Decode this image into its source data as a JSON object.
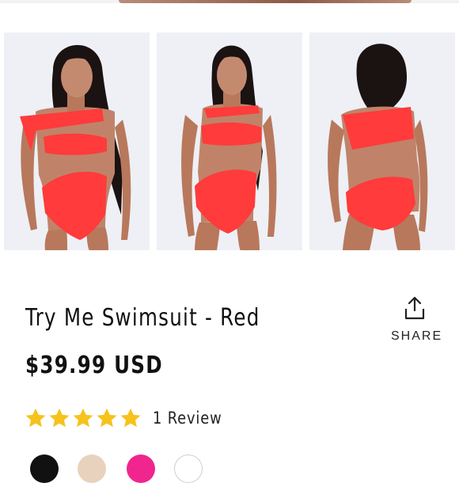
{
  "product": {
    "title": "Try Me Swimsuit - Red",
    "price": "$39.99 USD",
    "share_label": "SHARE",
    "rating": {
      "stars": 5,
      "max": 5,
      "review_label": "1 Review"
    }
  },
  "gallery": {
    "images": [
      {
        "name": "front-view",
        "icon": "model-photo"
      },
      {
        "name": "front-view-alt",
        "icon": "model-photo"
      },
      {
        "name": "back-view",
        "icon": "model-photo"
      }
    ]
  },
  "swatches": [
    {
      "color": "#111111"
    },
    {
      "color": "#e8d2bd"
    },
    {
      "color": "#f0258e"
    },
    {
      "color": "#ffffff"
    }
  ],
  "colors": {
    "swimsuit": "#ff3b3b",
    "star": "#f6c21c",
    "text": "#111111"
  }
}
